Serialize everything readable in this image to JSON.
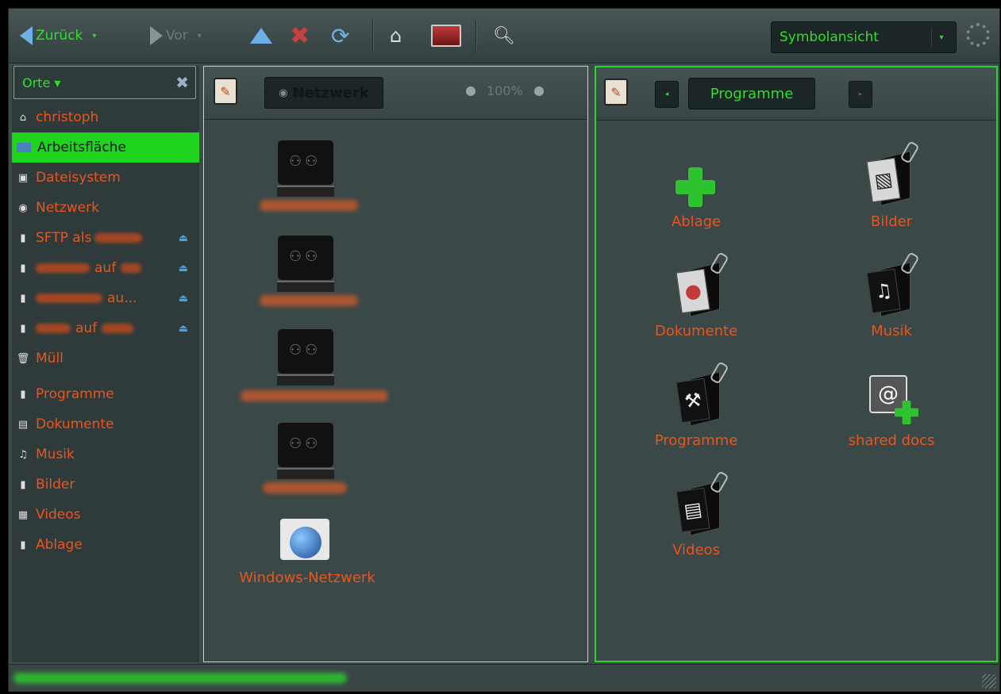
{
  "toolbar": {
    "back_label": "Zurück",
    "forward_label": "Vor",
    "view_mode": "Symbolansicht"
  },
  "sidebar": {
    "header": "Orte ▾",
    "items": [
      {
        "label": "christoph",
        "icon": "home-icon"
      },
      {
        "label": "Arbeitsfläche",
        "icon": "desktop-icon",
        "active": true
      },
      {
        "label": "Dateisystem",
        "icon": "harddisk-icon"
      },
      {
        "label": "Netzwerk",
        "icon": "network-icon"
      },
      {
        "label": "SFTP als",
        "icon": "drive-icon",
        "eject": true
      },
      {
        "label": "auf",
        "icon": "drive-icon",
        "eject": true
      },
      {
        "label": "au...",
        "icon": "drive-icon",
        "eject": true
      },
      {
        "label": "auf",
        "icon": "drive-icon",
        "eject": true
      },
      {
        "label": "Müll",
        "icon": "trash-icon"
      },
      {
        "label": "Programme",
        "icon": "folder-icon"
      },
      {
        "label": "Dokumente",
        "icon": "documents-icon"
      },
      {
        "label": "Musik",
        "icon": "music-icon"
      },
      {
        "label": "Bilder",
        "icon": "folder-icon"
      },
      {
        "label": "Videos",
        "icon": "video-icon"
      },
      {
        "label": "Ablage",
        "icon": "folder-icon"
      }
    ]
  },
  "left_pane": {
    "location": "Netzwerk",
    "zoom": "100%",
    "windows_network_label": "Windows-Netzwerk"
  },
  "right_pane": {
    "location": "Programme",
    "items": [
      {
        "label": "Ablage",
        "icon": "plus-icon"
      },
      {
        "label": "Bilder",
        "icon": "pictures-folder-icon"
      },
      {
        "label": "Dokumente",
        "icon": "documents-folder-icon"
      },
      {
        "label": "Musik",
        "icon": "music-folder-icon"
      },
      {
        "label": "Programme",
        "icon": "programs-folder-icon"
      },
      {
        "label": "shared docs",
        "icon": "shared-docs-icon"
      },
      {
        "label": "Videos",
        "icon": "videos-folder-icon"
      }
    ]
  },
  "colors": {
    "accent": "#2be02b",
    "label": "#e8551f",
    "background": "#3c4a4a"
  }
}
